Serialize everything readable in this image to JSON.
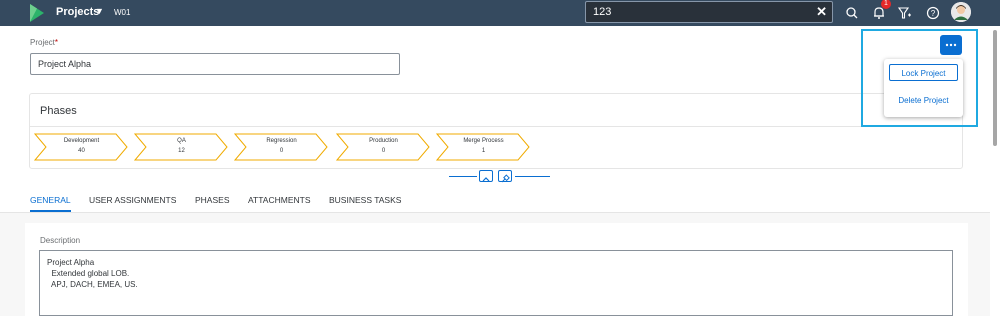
{
  "shellbar": {
    "app_title": "Projects",
    "app_subtitle": "W01",
    "search_value": "123",
    "notification_count": "1",
    "bg_color": "#354a5f"
  },
  "project": {
    "label": "Project",
    "required_marker": "*",
    "value": "Project Alpha"
  },
  "overflow_menu": {
    "items": [
      {
        "label": "Lock Project"
      },
      {
        "label": "Delete Project"
      }
    ]
  },
  "phases": {
    "title": "Phases",
    "steps": [
      {
        "name": "Development",
        "count": "40"
      },
      {
        "name": "QA",
        "count": "12"
      },
      {
        "name": "Regression",
        "count": "0"
      },
      {
        "name": "Production",
        "count": "0"
      },
      {
        "name": "Merge Process",
        "count": "1"
      }
    ],
    "step_color": "#f0ab00"
  },
  "tabs": [
    {
      "label": "GENERAL",
      "active": true
    },
    {
      "label": "USER ASSIGNMENTS"
    },
    {
      "label": "PHASES"
    },
    {
      "label": "ATTACHMENTS"
    },
    {
      "label": "BUSINESS TASKS"
    }
  ],
  "general": {
    "description_label": "Description",
    "description_lines": [
      "Project Alpha",
      "  Extended global LOB.",
      "  APJ, DACH, EMEA, US."
    ]
  },
  "accent_color": "#0a6ed1",
  "icons": [
    "sap-logo-icon",
    "search-icon",
    "bell-icon",
    "filter-icon",
    "help-icon",
    "avatar",
    "overflow-icon",
    "collapse-icon",
    "pin-icon"
  ]
}
